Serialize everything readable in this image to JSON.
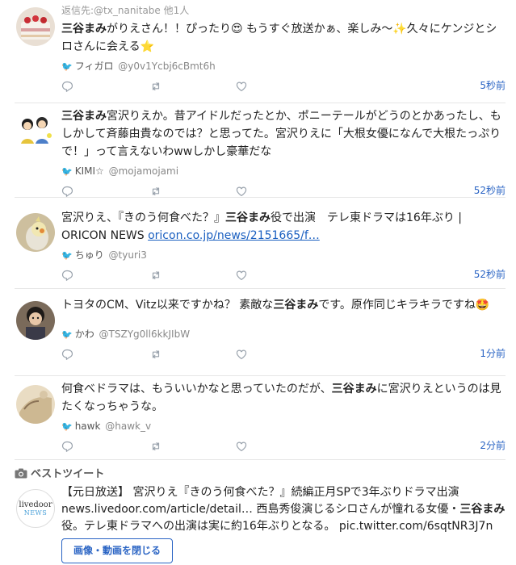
{
  "tweets": [
    {
      "reply_label": "返信先:",
      "reply_handle": "@tx_nanitabe",
      "reply_others": "他1人",
      "text_html": "<b>三谷まみ</b>がりえさん！！ぴったり😍 もうすぐ放送かぁ、楽しみ〜✨久々にケンジとシロさんに会える⭐",
      "name": "フィガロ",
      "handle": "@y0v1Ycbj6cBmt6h",
      "time": "5秒前"
    },
    {
      "text_html": "<b>三谷まみ</b>宮沢りえか。昔アイドルだったとか、ポニーテールがどうのとかあったし、もしかして斉藤由貴なのでは？と思ってた。宮沢りえに「大根女優になんで大根たっぷりで！」って言えないわwwしかし豪華だな",
      "name": "KIMI☆",
      "handle": "@mojamojami",
      "time": "52秒前"
    },
    {
      "text_html": "宮沢りえ、『きのう何食べた？』<b>三谷まみ</b>役で出演　テレ東ドラマは16年ぶり | ORICON NEWS <a>oricon.co.jp/news/2151665/f…</a>",
      "name": "ちゅり",
      "handle": "@tyuri3",
      "time": "52秒前"
    },
    {
      "text_html": "トヨタのCM、Vitz以来ですかね？ 素敵な<b>三谷まみ</b>です。原作同じキラキラですね🤩",
      "name": "かわ",
      "handle": "@TSZYg0ll6kkJIbW",
      "time": "1分前"
    },
    {
      "text_html": "何食べドラマは、もういいかなと思っていたのだが、<b>三谷まみ</b>に宮沢りえというのは見たくなっちゃうな。",
      "name": "hawk",
      "handle": "@hawk_v",
      "time": "2分前"
    }
  ],
  "best": {
    "title": "ベストツイート",
    "avatar_line1": "livedoor",
    "avatar_line2": "NEWS",
    "text_html": "【元日放送】 宮沢りえ『きのう何食べた？』続編正月SPで3年ぶりドラマ出演 <a>news.livedoor.com/article/detail…</a> 西島秀俊演じるシロさんが憧れる女優・<b>三谷まみ</b>役。テレ東ドラマへの出演は実に約16年ぶりとなる。 <a>pic.twitter.com/6sqtNR3J7n</a>",
    "close_label": "画像・動画を閉じる"
  },
  "colors": {
    "link": "#2a64c4",
    "twitter_bird": "#1da1f2",
    "divider": "#e6e6e6"
  }
}
